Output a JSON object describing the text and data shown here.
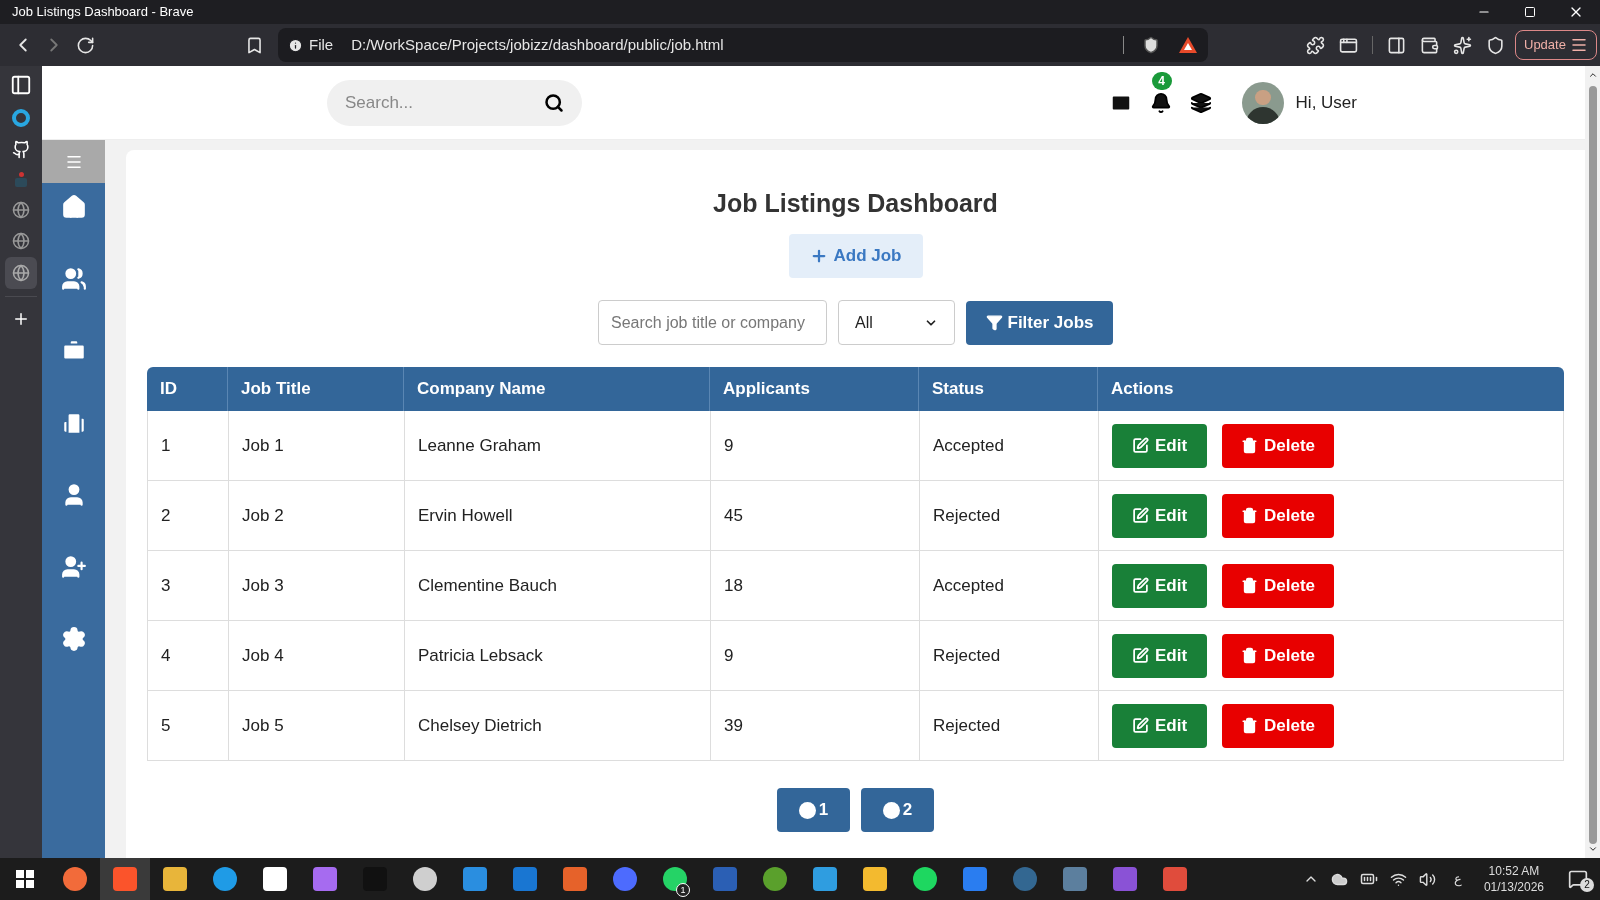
{
  "window": {
    "title": "Job Listings Dashboard - Brave"
  },
  "browser": {
    "scheme": "File",
    "url": "D:/WorkSpace/Projects/jobizz/dashboard/public/job.html",
    "update_button": "Update"
  },
  "header": {
    "search": {
      "placeholder": "Search..."
    },
    "notification_count": "4",
    "greeting": "Hi, User"
  },
  "sidebar": {
    "menu_toggle": {
      "selected": true
    }
  },
  "page": {
    "title": "Job Listings Dashboard",
    "add_button": "Add Job",
    "filter": {
      "search": {
        "placeholder": "Search job title or company"
      },
      "select": {
        "value": "All"
      },
      "button": "Filter Jobs"
    }
  },
  "table": {
    "columns": [
      "ID",
      "Job Title",
      "Company Name",
      "Applicants",
      "Status",
      "Actions"
    ],
    "rows": [
      {
        "id": "1",
        "title": "Job 1",
        "company": "Leanne Graham",
        "applicants": "9",
        "status": "Accepted",
        "edit": "Edit",
        "delete": "Delete"
      },
      {
        "id": "2",
        "title": "Job 2",
        "company": "Ervin Howell",
        "applicants": "45",
        "status": "Rejected",
        "edit": "Edit",
        "delete": "Delete"
      },
      {
        "id": "3",
        "title": "Job 3",
        "company": "Clementine Bauch",
        "applicants": "18",
        "status": "Accepted",
        "edit": "Edit",
        "delete": "Delete"
      },
      {
        "id": "4",
        "title": "Job 4",
        "company": "Patricia Lebsack",
        "applicants": "9",
        "status": "Rejected",
        "edit": "Edit",
        "delete": "Delete"
      },
      {
        "id": "5",
        "title": "Job 5",
        "company": "Chelsey Dietrich",
        "applicants": "39",
        "status": "Rejected",
        "edit": "Edit",
        "delete": "Delete"
      }
    ]
  },
  "pagination": [
    {
      "label": "1"
    },
    {
      "label": "2"
    }
  ],
  "taskbar": {
    "app_badge": "1",
    "keyboard": "ع",
    "time": "10:52 AM",
    "date": "01/13/2026",
    "notification_count": "2"
  }
}
